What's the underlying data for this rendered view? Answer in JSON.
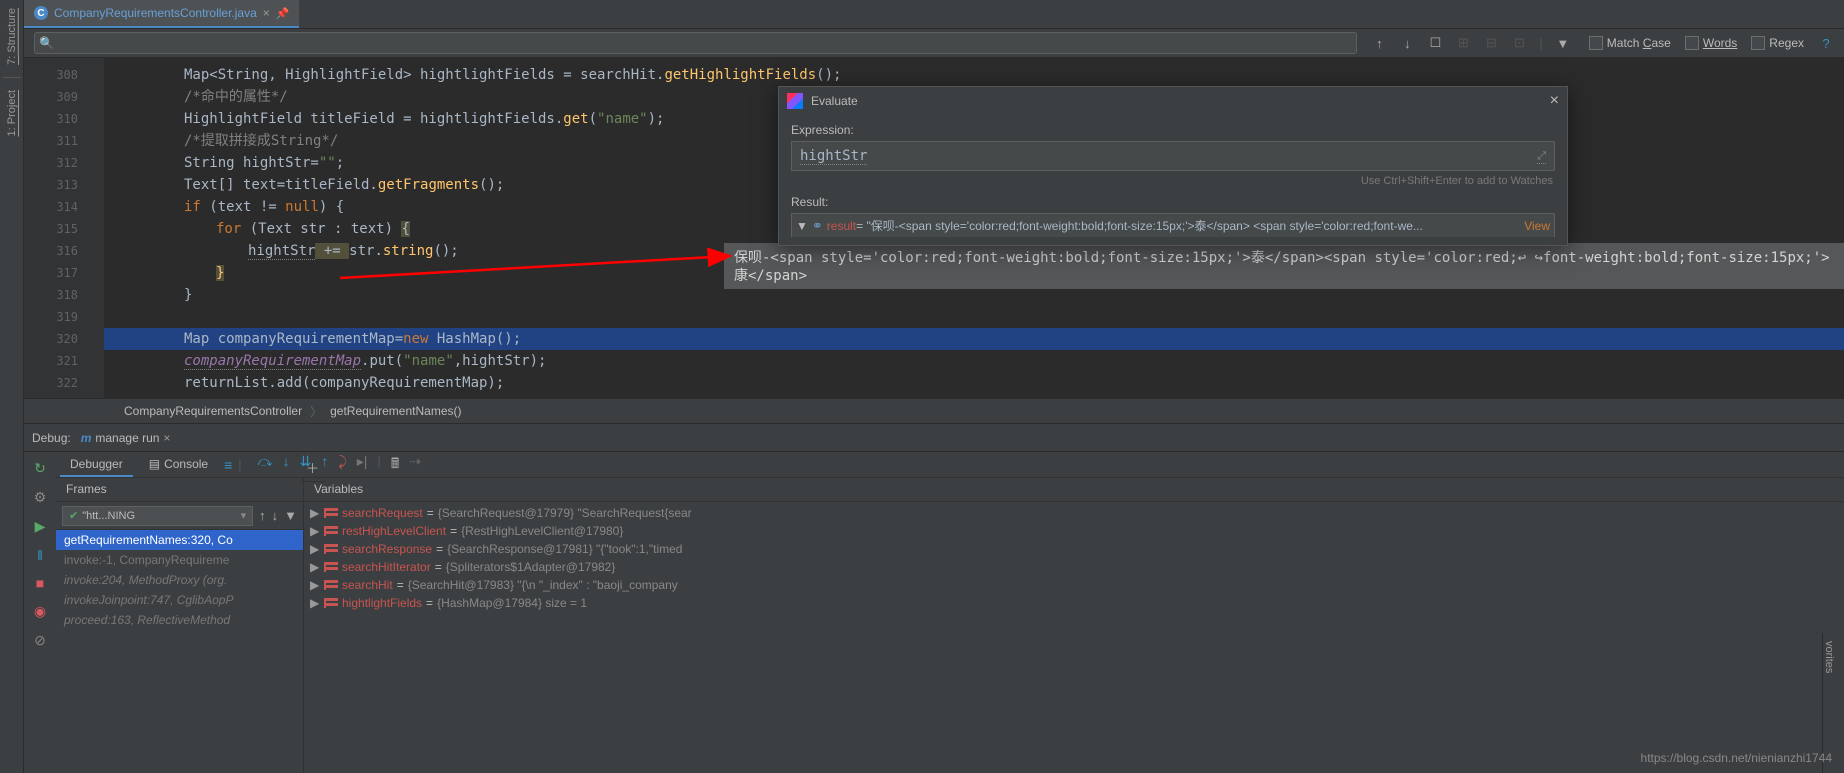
{
  "tab": {
    "label": "CompanyRequirementsController.java",
    "icon_letter": "C"
  },
  "search": {
    "placeholder": "",
    "options": {
      "match_case": "Match Case",
      "words": "Words",
      "regex": "Regex"
    }
  },
  "gutter": [
    "308",
    "309",
    "310",
    "311",
    "312",
    "313",
    "314",
    "315",
    "316",
    "317",
    "318",
    "319",
    "320",
    "321",
    "322"
  ],
  "code": {
    "l308_a": "Map<String, HighlightField> hightlightFields = searchHit.",
    "l308_b": "getHighlightFields",
    "l308_c": "();",
    "l309": "/*命中的属性*/",
    "l310_a": "HighlightField titleField = hightlightFields.",
    "l310_b": "get",
    "l310_c": "(",
    "l310_d": "\"name\"",
    "l310_e": ");",
    "l311": "/*提取拼接成String*/",
    "l312_a": "String hightStr=",
    "l312_b": "\"\"",
    "l312_c": ";",
    "l313_a": "Text[] text=titleField.",
    "l313_b": "getFragments",
    "l313_c": "();",
    "l314_a": "if",
    "l314_b": " (text != ",
    "l314_c": "null",
    "l314_d": ") {",
    "l315_a": "for",
    "l315_b": " (Text str : text) ",
    "l315_c": "{",
    "l316_a": "hightStr",
    "l316_b": " += ",
    "l316_c": "str.",
    "l316_d": "string",
    "l316_e": "();",
    "l317": "}",
    "l318": "}",
    "l320_a": "Map companyRequirementMap=",
    "l320_b": "new",
    "l320_c": " HashMap();",
    "l321_a": "companyRequirementMap",
    "l321_b": ".put(",
    "l321_c": "\"name\"",
    "l321_d": ",hightStr);",
    "l322_a": "returnList.add(companyRequirementMap);"
  },
  "breadcrumb": {
    "a": "CompanyRequirementsController",
    "b": "getRequirementNames()"
  },
  "debug": {
    "title": "Debug:",
    "run_config": "manage run",
    "tabs": {
      "debugger": "Debugger",
      "console": "Console"
    },
    "frames_header": "Frames",
    "variables_header": "Variables",
    "thread": "\"htt...NING",
    "frames": [
      "getRequirementNames:320, Co",
      "invoke:-1, CompanyRequireme",
      "invoke:204, MethodProxy (org.",
      "invokeJoinpoint:747, CglibAopP",
      "proceed:163, ReflectiveMethod"
    ],
    "variables": [
      {
        "name": "searchRequest",
        "val": "{SearchRequest@17979} \"SearchRequest{sear"
      },
      {
        "name": "restHighLevelClient",
        "val": "{RestHighLevelClient@17980}"
      },
      {
        "name": "searchResponse",
        "val": "{SearchResponse@17981} \"{\"took\":1,\"timed"
      },
      {
        "name": "searchHitIterator",
        "val": "{Spliterators$1Adapter@17982}"
      },
      {
        "name": "searchHit",
        "val": "{SearchHit@17983} \"{\\n  \"_index\" : \"baoji_company"
      },
      {
        "name": "hightlightFields",
        "val": "{HashMap@17984}  size = 1"
      }
    ]
  },
  "evaluate": {
    "title": "Evaluate",
    "expr_label": "Expression:",
    "expr_value": "hightStr",
    "hint": "Use Ctrl+Shift+Enter to add to Watches",
    "result_label": "Result:",
    "result_name": "result",
    "result_val": " = \"保呗-<span style='color:red;font-weight:bold;font-size:15px;'>泰</span> <span style='color:red;font-we...",
    "view": "View"
  },
  "result_text": "保呗-<span style='color:red;font-weight:bold;font-size:15px;'>泰</span><span style='color:red;↩\n↪font-weight:bold;font-size:15px;'>康</span>",
  "left_tools": {
    "structure": "Structure",
    "project": "1: Project",
    "struct_num": "7:"
  },
  "right_tools": {
    "favorites": "vorites"
  },
  "watermark": "https://blog.csdn.net/nienianzhi1744"
}
